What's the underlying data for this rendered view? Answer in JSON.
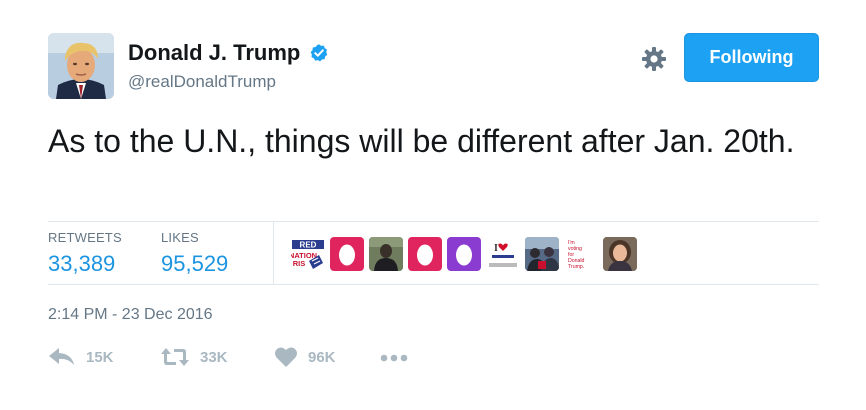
{
  "author": {
    "display_name": "Donald J. Trump",
    "handle": "@realDonaldTrump",
    "verified": true,
    "avatar_icon": "profile-photo"
  },
  "header": {
    "follow_label": "Following",
    "settings_icon": "gear-icon"
  },
  "tweet": {
    "text": "As to the U.N., things will be different after Jan. 20th."
  },
  "stats": {
    "retweets_label": "RETWEETS",
    "retweets_value": "33,389",
    "likes_label": "LIKES",
    "likes_value": "95,529"
  },
  "likers": {
    "badge_red": "RED",
    "badge_nation": "NATION",
    "badge_ris": "RIS",
    "badge_i": "I",
    "voting_lines": [
      "I'm",
      "voting",
      "for",
      "Donald",
      "Trump."
    ]
  },
  "timestamp": "2:14 PM - 23 Dec 2016",
  "actions": {
    "reply_count": "15K",
    "retweet_count": "33K",
    "like_count": "96K",
    "more_icon": "more-dots-icon"
  },
  "colors": {
    "accent": "#1da1f2",
    "text": "#14171a",
    "muted": "#657786",
    "action_gray": "#aab8c2",
    "egg_pink": "#e0245e",
    "egg_purple": "#8a3cd0"
  }
}
